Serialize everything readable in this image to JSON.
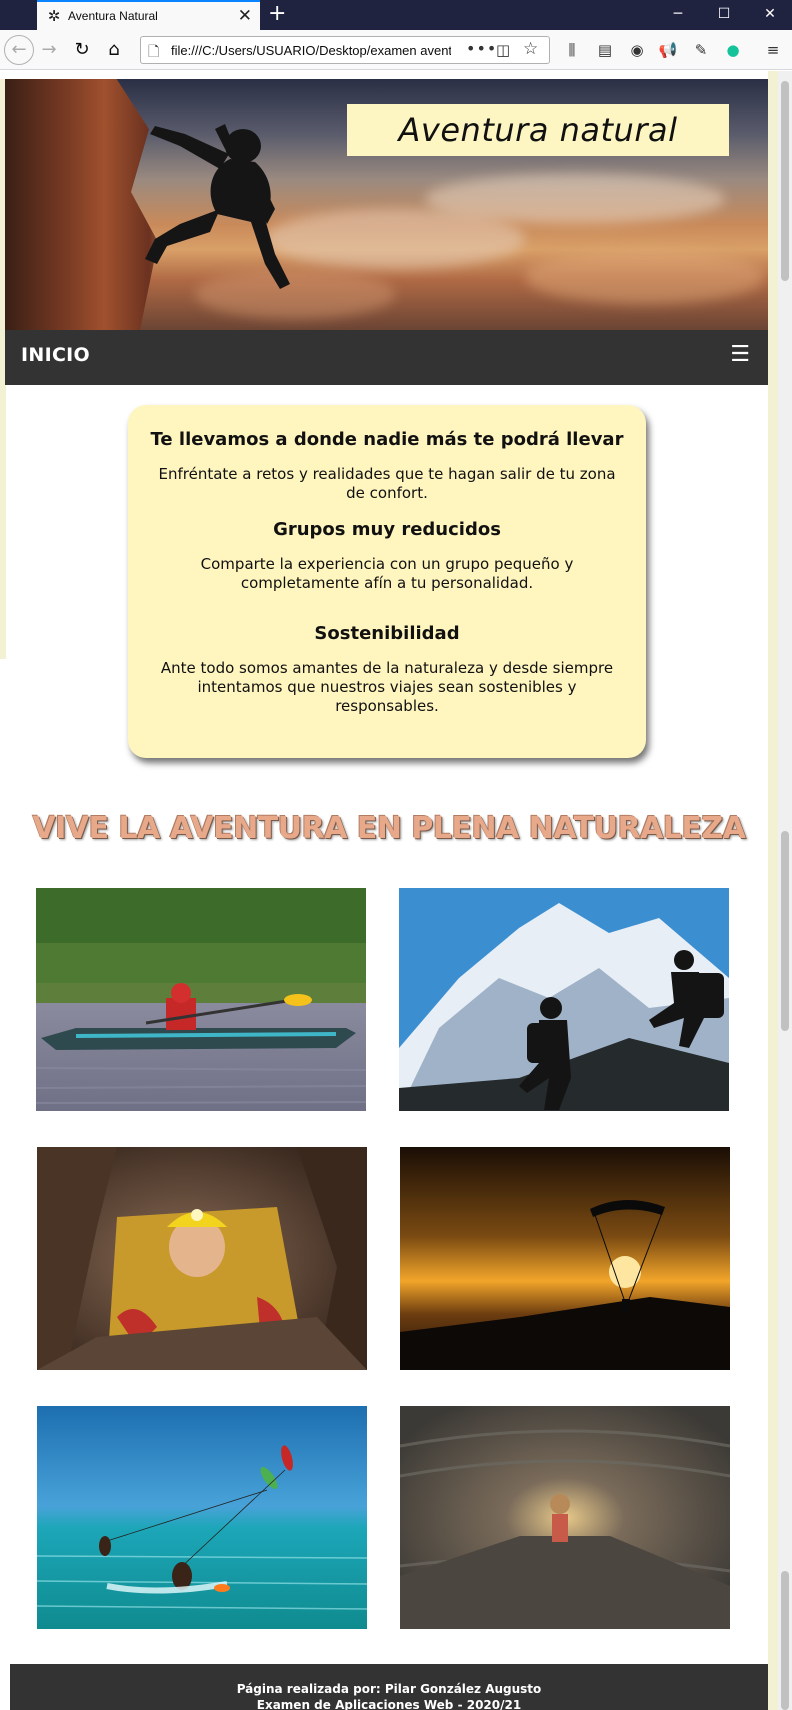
{
  "browser": {
    "tab_title": "Aventura Natural",
    "url": "file:///C:/Users/USUARIO/Desktop/examen aventura",
    "new_tab_symbol": "+",
    "close_symbol": "✕",
    "minimize_symbol": "─",
    "maximize_symbol": "☐",
    "window_close_symbol": "✕"
  },
  "site": {
    "logo_text": "Aventura natural",
    "nav_home": "INICIO",
    "menu_symbol": "☰",
    "card": {
      "sections": [
        {
          "title": "Te llevamos a donde nadie más te podrá llevar",
          "text": "Enfréntate a retos y realidades que te hagan salir de tu zona de confort."
        },
        {
          "title": "Grupos muy reducidos",
          "text": "Comparte la experiencia con un grupo pequeño y completamente afín a tu personalidad."
        },
        {
          "title": "Sostenibilidad",
          "text": "Ante todo somos amantes de la naturaleza y desde siempre intentamos que nuestros viajes sean sostenibles y responsables."
        }
      ]
    },
    "headline": "VIVE LA AVENTURA EN PLENA NATURALEZA",
    "gallery": [
      "kayak",
      "mountain-hikers",
      "caving",
      "paragliding",
      "kitesurf",
      "cave-tunnel"
    ],
    "footer": {
      "line1": "Página realizada por: Pilar González Augusto",
      "line2": "Examen de Aplicaciones Web - 2020/21"
    }
  },
  "colors": {
    "card_bg": "#fff5bf",
    "nav_bg": "#333333",
    "headline": "#e8a98b",
    "tab_accent": "#0a84ff",
    "chrome_dark": "#202340"
  }
}
